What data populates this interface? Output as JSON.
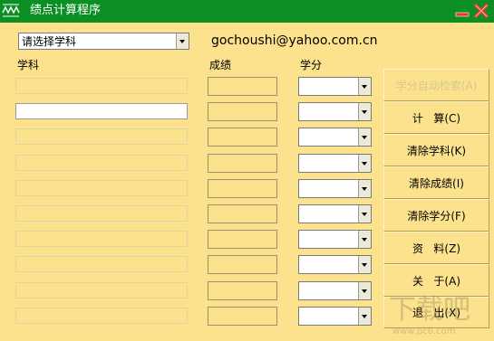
{
  "window": {
    "title": "绩点计算程序"
  },
  "subject_select": {
    "value": "请选择学科"
  },
  "email": "gochoushi@yahoo.com.cn",
  "headers": {
    "subject": "学科",
    "score": "成绩",
    "credit": "学分"
  },
  "row_count": 10,
  "buttons": [
    {
      "label": "学分自动检索(A)",
      "enabled": false
    },
    {
      "label": "计   算(C)",
      "enabled": true
    },
    {
      "label": "清除学科(K)",
      "enabled": true
    },
    {
      "label": "清除成绩(I)",
      "enabled": true
    },
    {
      "label": "清除学分(F)",
      "enabled": true
    },
    {
      "label": "资   料(Z)",
      "enabled": true
    },
    {
      "label": "关   于(A)",
      "enabled": true
    },
    {
      "label": "退   出(X)",
      "enabled": true
    }
  ],
  "watermark": {
    "text": "www.pc6.com"
  },
  "colors": {
    "titlebar": "#0b8f24",
    "background": "#fde28e",
    "close": "#e33b2b"
  }
}
